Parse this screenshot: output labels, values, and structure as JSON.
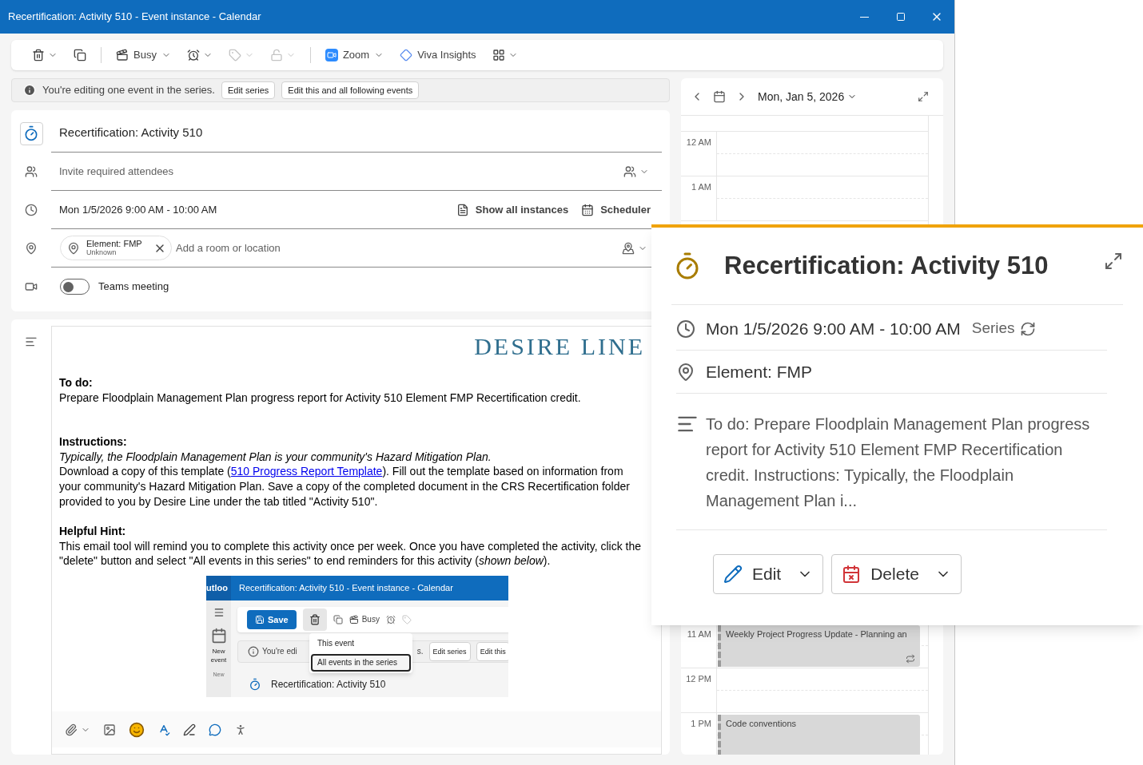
{
  "window": {
    "title": "Recertification: Activity 510 - Event instance - Calendar"
  },
  "toolbar": {
    "tools": [
      {
        "kind": "delete",
        "disabled": false
      },
      {
        "kind": "copy",
        "disabled": false
      },
      {
        "kind": "separator"
      },
      {
        "kind": "show-as",
        "label": "Busy",
        "disabled": false
      },
      {
        "kind": "reminder",
        "disabled": false
      },
      {
        "kind": "categorize",
        "disabled": true
      },
      {
        "kind": "private",
        "disabled": true
      },
      {
        "kind": "separator"
      },
      {
        "kind": "zoom",
        "label": "Zoom",
        "disabled": false
      },
      {
        "kind": "insights",
        "label": "Viva Insights",
        "disabled": false
      },
      {
        "kind": "apps",
        "disabled": false
      }
    ]
  },
  "info_bar": {
    "message": "You're editing one event in the series.",
    "buttons": [
      "Edit series",
      "Edit this and all following events"
    ]
  },
  "form": {
    "title": "Recertification: Activity 510",
    "attendees_placeholder": "Invite required attendees",
    "time": "Mon 1/5/2026 9:00 AM - 10:00 AM",
    "actions": [
      "Show all instances",
      "Scheduler"
    ],
    "location": {
      "name": "Element: FMP",
      "status": "Unknown",
      "placeholder": "Add a room or location"
    },
    "teams": {
      "label": "Teams meeting",
      "on": false
    }
  },
  "body": {
    "logo": "DESIRE LINE",
    "todo_heading": "To do:",
    "todo_text": "Prepare Floodplain Management Plan progress report for Activity 510 Element FMP Recertification credit.",
    "instructions_heading": "Instructions:",
    "instructions_note": "Typically, the Floodplain Management Plan is your community's Hazard Mitigation Plan.",
    "instructions_before": "Download a copy of this template (",
    "instructions_link": "510 Progress Report Template",
    "instructions_after": "). Fill out the template based on information from your community's Hazard Mitigation Plan. Save a copy of the completed document in the CRS Recertification folder provided to you by Desire Line under the tab titled \"Activity 510\".",
    "hint_heading": "Helpful Hint:",
    "hint_text": "This email tool will remind you to complete this activity once per week. Once you have completed the activity, click the \"delete\" button and select \"All events in this series\" to end reminders for this activity (*shown below*).",
    "screenshot": {
      "app": "utloo",
      "title": "Recertification: Activity 510 - Event instance - Calendar",
      "save": "Save",
      "busy": "Busy",
      "new_event": "New event",
      "group": "New",
      "info": "You're edi",
      "info_tail": "s.",
      "buttons": [
        "Edit series",
        "Edit this"
      ],
      "event_title": "Recertification: Activity 510",
      "menu": [
        {
          "label": "This event",
          "selected": false
        },
        {
          "label": "All events in the series",
          "selected": true
        }
      ]
    }
  },
  "calendar": {
    "date": "Mon, Jan 5, 2026",
    "hours_top": [
      {
        "label": "12 AM"
      },
      {
        "label": "1 AM"
      }
    ],
    "hours_bottom": [
      {
        "label": "11 AM",
        "event": {
          "title": "Weekly Project Progress Update - Planning an",
          "recurring": true
        }
      },
      {
        "label": "12 PM"
      },
      {
        "label": "1 PM",
        "event": {
          "title": "Code conventions",
          "recurring": false
        }
      }
    ]
  },
  "popup": {
    "title": "Recertification: Activity 510",
    "time": "Mon 1/5/2026 9:00 AM - 10:00 AM",
    "series": "Series",
    "location": "Element: FMP",
    "description": "To do: Prepare Floodplain Management Plan progress report for Activity 510 Element FMP Recertification credit. Instructions: Typically, the Floodplain Management Plan i...",
    "buttons": [
      {
        "kind": "edit",
        "label": "Edit"
      },
      {
        "kind": "delete",
        "label": "Delete"
      }
    ]
  }
}
